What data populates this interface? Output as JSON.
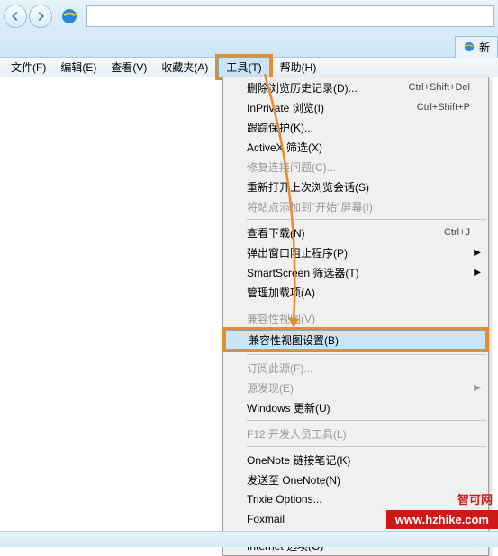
{
  "tab": {
    "label": "新"
  },
  "menubar": {
    "file": "文件(F)",
    "edit": "编辑(E)",
    "view": "查看(V)",
    "favorites": "收藏夹(A)",
    "tools": "工具(T)",
    "help": "帮助(H)"
  },
  "dropdown": {
    "items": [
      {
        "label": "删除浏览历史记录(D)...",
        "shortcut": "Ctrl+Shift+Del",
        "type": "item"
      },
      {
        "label": "InPrivate 浏览(I)",
        "shortcut": "Ctrl+Shift+P",
        "type": "item"
      },
      {
        "label": "跟踪保护(K)...",
        "type": "item"
      },
      {
        "label": "ActiveX 筛选(X)",
        "type": "item"
      },
      {
        "label": "修复连接问题(C)...",
        "type": "disabled"
      },
      {
        "label": "重新打开上次浏览会话(S)",
        "type": "item"
      },
      {
        "label": "将站点添加到\"开始\"屏幕(I)",
        "type": "disabled"
      },
      {
        "type": "sep"
      },
      {
        "label": "查看下载(N)",
        "shortcut": "Ctrl+J",
        "type": "item"
      },
      {
        "label": "弹出窗口阻止程序(P)",
        "type": "submenu"
      },
      {
        "label": "SmartScreen 筛选器(T)",
        "type": "submenu"
      },
      {
        "label": "管理加载项(A)",
        "type": "item"
      },
      {
        "type": "sep"
      },
      {
        "label": "兼容性视图(V)",
        "type": "disabled"
      },
      {
        "label": "兼容性视图设置(B)",
        "type": "hover-highlight"
      },
      {
        "type": "sep"
      },
      {
        "label": "订阅此源(F)...",
        "type": "disabled"
      },
      {
        "label": "源发现(E)",
        "type": "submenu-disabled"
      },
      {
        "label": "Windows 更新(U)",
        "type": "item"
      },
      {
        "type": "sep"
      },
      {
        "label": "F12 开发人员工具(L)",
        "type": "disabled"
      },
      {
        "type": "sep"
      },
      {
        "label": "OneNote 链接笔记(K)",
        "type": "item"
      },
      {
        "label": "发送至 OneNote(N)",
        "type": "item"
      },
      {
        "label": "Trixie Options...",
        "type": "item"
      },
      {
        "label": "Foxmail",
        "type": "item"
      },
      {
        "type": "sep"
      },
      {
        "label": "Internet 选项(O)",
        "type": "item"
      }
    ]
  },
  "watermark": {
    "text": "智可网",
    "url": "www.hzhike.com"
  }
}
